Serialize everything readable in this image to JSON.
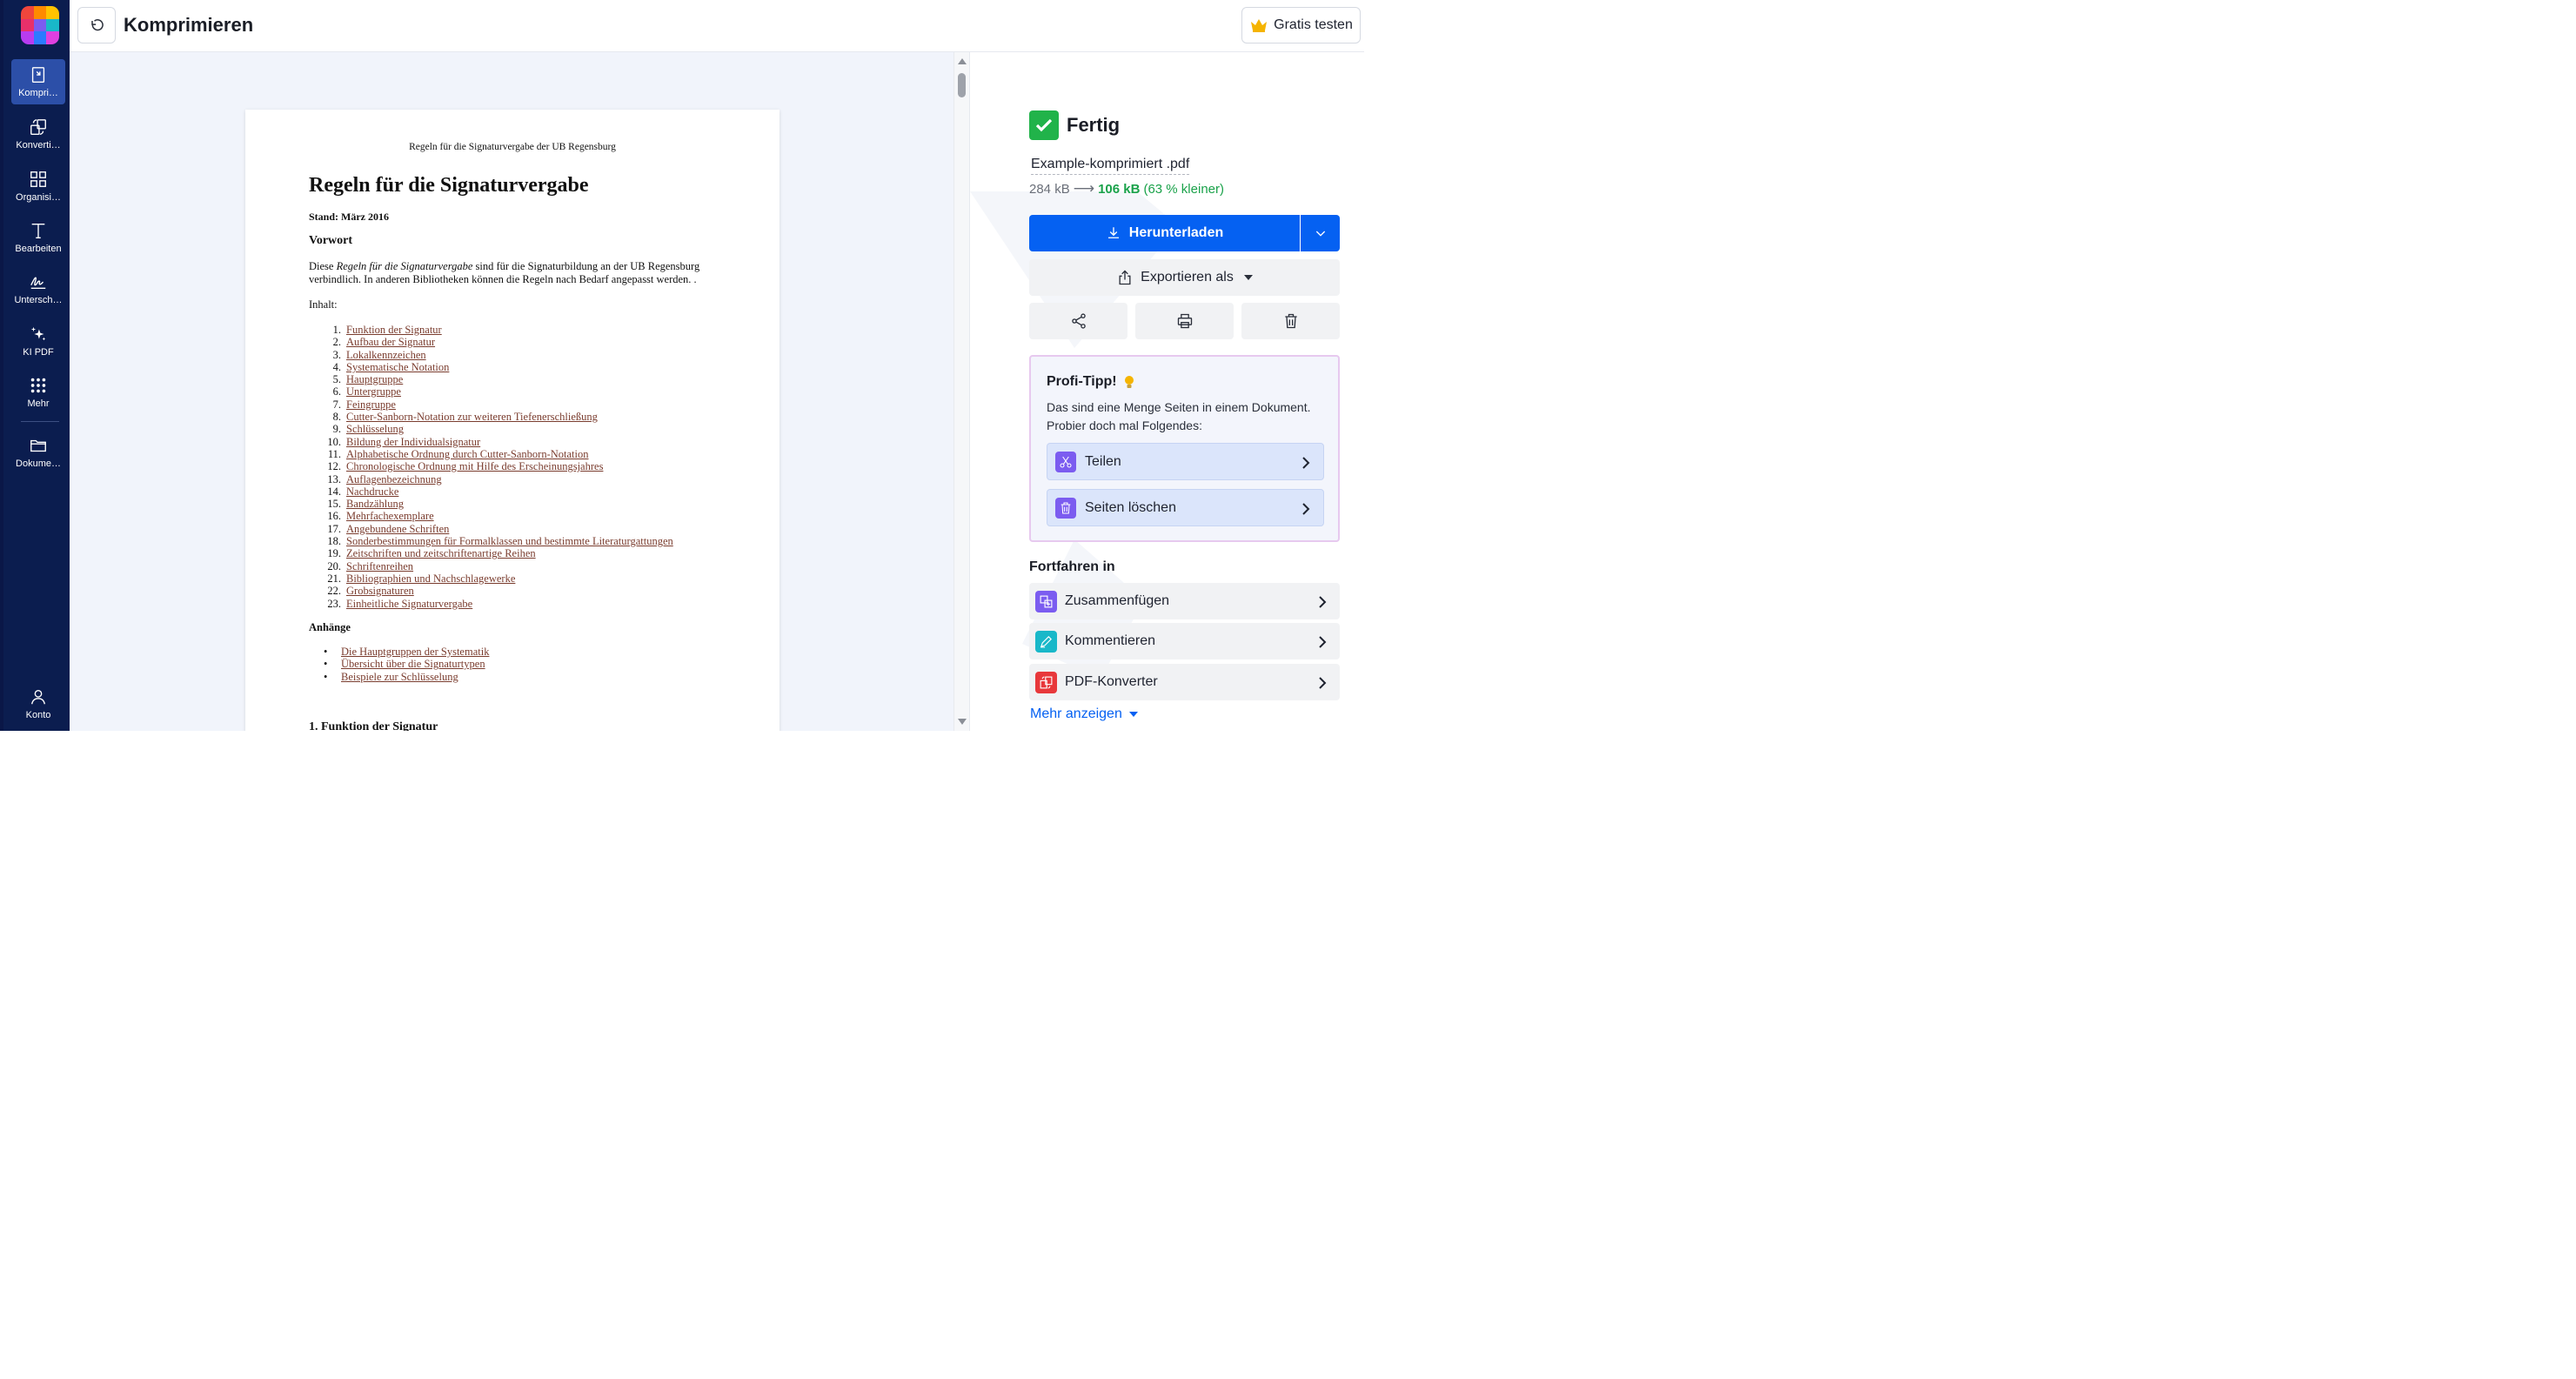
{
  "colors": {
    "sidebar_bg": "#0b1d4f",
    "sidebar_active": "#2c4fa8",
    "accent_blue": "#0561f2",
    "success_green": "#1aa24a",
    "link_brown": "#7a3c2e"
  },
  "sidebar": {
    "items": [
      {
        "icon": "compress-icon",
        "label": "Kompri…"
      },
      {
        "icon": "convert-icon",
        "label": "Konverti…"
      },
      {
        "icon": "grid-icon",
        "label": "Organisi…"
      },
      {
        "icon": "text-icon",
        "label": "Bearbeiten"
      },
      {
        "icon": "signature-icon",
        "label": "Untersch…"
      },
      {
        "icon": "sparkle-icon",
        "label": "KI PDF"
      },
      {
        "icon": "dots-grid-icon",
        "label": "Mehr"
      },
      {
        "icon": "folder-icon",
        "label": "Dokume…"
      },
      {
        "icon": "user-icon",
        "label": "Konto"
      }
    ]
  },
  "header": {
    "title": "Komprimieren",
    "trial_label": "Gratis testen"
  },
  "document": {
    "running_header": "Regeln für die Signaturvergabe der UB Regensburg",
    "title": "Regeln für die Signaturvergabe",
    "stand": "Stand: März 2016",
    "vorwort_heading": "Vorwort",
    "intro_prefix": "Diese ",
    "intro_italic": "Regeln für die Signaturvergabe",
    "intro_line1_rest": " sind für die Signaturbildung an der UB Regensburg",
    "intro_line2": "verbindlich. In anderen Bibliotheken können die Regeln nach Bedarf angepasst werden. .",
    "inhalt_label": "Inhalt:",
    "toc": [
      {
        "num": "1.",
        "text": "Funktion der Signatur"
      },
      {
        "num": "2.",
        "text": "Aufbau der Signatur"
      },
      {
        "num": "3.",
        "text": "Lokalkennzeichen"
      },
      {
        "num": "4.",
        "text": "Systematische Notation"
      },
      {
        "num": "5.",
        "text": "Hauptgruppe"
      },
      {
        "num": "6.",
        "text": "Untergruppe"
      },
      {
        "num": "7.",
        "text": "Feingruppe"
      },
      {
        "num": "8.",
        "text": "Cutter-Sanborn-Notation zur weiteren Tiefenerschließung"
      },
      {
        "num": "9.",
        "text": "Schlüsselung"
      },
      {
        "num": "10.",
        "text": "Bildung der Individualsignatur"
      },
      {
        "num": "11.",
        "text": "Alphabetische Ordnung durch Cutter-Sanborn-Notation"
      },
      {
        "num": "12.",
        "text": "Chronologische Ordnung mit Hilfe des Erscheinungsjahres"
      },
      {
        "num": "13.",
        "text": "Auflagenbezeichnung"
      },
      {
        "num": "14.",
        "text": "Nachdrucke"
      },
      {
        "num": "15.",
        "text": "Bandzählung"
      },
      {
        "num": "16.",
        "text": "Mehrfachexemplare"
      },
      {
        "num": "17.",
        "text": "Angebundene Schriften"
      },
      {
        "num": "18.",
        "text": "Sonderbestimmungen für Formalklassen und bestimmte Literaturgattungen"
      },
      {
        "num": "19.",
        "text": "Zeitschriften und zeitschriftenartige Reihen"
      },
      {
        "num": "20.",
        "text": "Schriftenreihen"
      },
      {
        "num": "21.",
        "text": "Bibliographien und Nachschlagewerke"
      },
      {
        "num": "22.",
        "text": "Grobsignaturen"
      },
      {
        "num": "23.",
        "text": "Einheitliche Signaturvergabe"
      }
    ],
    "anhaenge_heading": "Anhänge",
    "anhaenge": [
      {
        "bullet": "•",
        "text": "Die Hauptgruppen der Systematik"
      },
      {
        "bullet": "•",
        "text": "Übersicht über die Signaturtypen"
      },
      {
        "bullet": "•",
        "text": "Beispiele zur Schlüsselung"
      }
    ],
    "section1_heading": "1. Funktion der Signatur"
  },
  "result": {
    "status": "Fertig",
    "filename": "Example-komprimiert .pdf",
    "original_size": "284 kB",
    "arrow": "⟶",
    "new_size": "106 kB",
    "reduction": "(63 % kleiner)",
    "download_label": "Herunterladen",
    "export_label": "Exportieren als"
  },
  "tip": {
    "title": "Profi-Tipp!",
    "text": "Das sind eine Menge Seiten in einem Dokument. Probier doch mal Folgendes:",
    "actions": [
      {
        "icon": "scissors-icon",
        "label": "Teilen"
      },
      {
        "icon": "trash-icon",
        "label": "Seiten löschen"
      }
    ]
  },
  "continue_in": {
    "title": "Fortfahren in",
    "items": [
      {
        "icon": "merge-icon",
        "label": "Zusammenfügen",
        "color": "#7b5cf0"
      },
      {
        "icon": "pencil-icon",
        "label": "Kommentieren",
        "color": "#19b8c9"
      },
      {
        "icon": "pdf-convert-icon",
        "label": "PDF-Konverter",
        "color": "#e8383b"
      }
    ],
    "more_label": "Mehr anzeigen"
  }
}
